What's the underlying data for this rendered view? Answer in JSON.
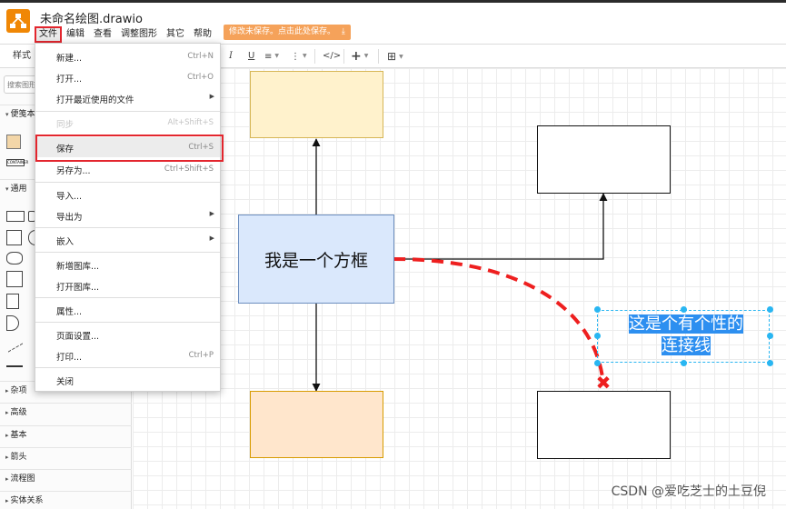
{
  "app": {
    "title": "未命名绘图.drawio",
    "save_notice": "修改未保存。点击此处保存。"
  },
  "menubar": {
    "items": [
      "文件",
      "编辑",
      "查看",
      "调整图形",
      "其它",
      "帮助"
    ]
  },
  "toolbar": {
    "sidebar_tab": "样式",
    "italic": "I",
    "underline": "U",
    "align": "≡",
    "more": "⋮",
    "code": "</>",
    "insert": "+",
    "table": "⊞"
  },
  "sidebar": {
    "search_placeholder": "搜索图形",
    "sections": [
      "便笺本",
      "通用",
      "杂项",
      "高级",
      "基本",
      "箭头",
      "流程图",
      "实体关系"
    ],
    "scratchpad_shape_label": "CONTAINER"
  },
  "file_menu": {
    "items": [
      {
        "label": "新建...",
        "shortcut": "Ctrl+N"
      },
      {
        "label": "打开...",
        "shortcut": "Ctrl+O"
      },
      {
        "label": "打开最近使用的文件",
        "submenu": true
      },
      {
        "label": "同步",
        "shortcut": "Alt+Shift+S",
        "disabled": true
      },
      {
        "label": "保存",
        "shortcut": "Ctrl+S",
        "highlighted": true
      },
      {
        "label": "另存为...",
        "shortcut": "Ctrl+Shift+S"
      },
      {
        "label": "导入..."
      },
      {
        "label": "导出为",
        "submenu": true
      },
      {
        "label": "嵌入",
        "submenu": true
      },
      {
        "label": "新增图库..."
      },
      {
        "label": "打开图库..."
      },
      {
        "label": "属性..."
      },
      {
        "label": "页面设置..."
      },
      {
        "label": "打印...",
        "shortcut": "Ctrl+P"
      },
      {
        "label": "关闭"
      }
    ]
  },
  "canvas": {
    "center_box_label": "我是一个方框",
    "edge_label_line1": "这是个有个性的",
    "edge_label_line2": "连接线"
  },
  "colors": {
    "accent_orange": "#f08705",
    "highlight_red": "#e3262e",
    "selection_blue": "#29b6f2",
    "center_fill": "#dae8fc",
    "center_stroke": "#6c8ebf",
    "top_fill": "#fff2cc",
    "top_stroke": "#d6b656",
    "bottom_fill": "#ffe6cc",
    "bottom_stroke": "#d79b00",
    "dashed_edge": "#ee1f1f"
  },
  "watermark": "CSDN @爱吃芝士的土豆倪"
}
